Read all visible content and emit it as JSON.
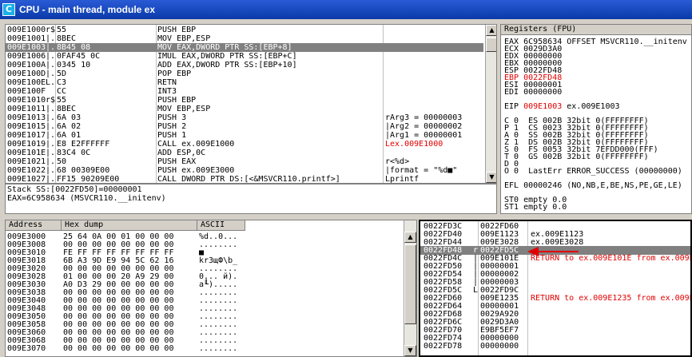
{
  "window": {
    "title": "CPU - main thread, module ex",
    "icon_letter": "C"
  },
  "cpu": {
    "rows": [
      {
        "addr": "009E1000",
        "mark": "r$",
        "bytes": "55",
        "asm": "PUSH EBP",
        "com": ""
      },
      {
        "addr": "009E1001",
        "mark": "|.",
        "bytes": "8BEC",
        "asm": "MOV EBP,ESP",
        "com": ""
      },
      {
        "addr": "009E1003",
        "mark": "|.",
        "bytes": "8B45 08",
        "asm": "MOV EAX,DWORD PTR SS:[EBP+8]",
        "com": ""
      },
      {
        "addr": "009E1006",
        "mark": "|.",
        "bytes": "0FAF45 0C",
        "asm": "IMUL EAX,DWORD PTR SS:[EBP+C]",
        "com": ""
      },
      {
        "addr": "009E100A",
        "mark": "|.",
        "bytes": "0345 10",
        "asm": "ADD EAX,DWORD PTR SS:[EBP+10]",
        "com": ""
      },
      {
        "addr": "009E100D",
        "mark": "|.",
        "bytes": "5D",
        "asm": "POP EBP",
        "com": ""
      },
      {
        "addr": "009E100E",
        "mark": "L.",
        "bytes": "C3",
        "asm": "RETN",
        "com": ""
      },
      {
        "addr": "009E100F",
        "mark": "  ",
        "bytes": "CC",
        "asm": "INT3",
        "com": ""
      },
      {
        "addr": "009E1010",
        "mark": "r$",
        "bytes": "55",
        "asm": "PUSH EBP",
        "com": ""
      },
      {
        "addr": "009E1011",
        "mark": "|.",
        "bytes": "8BEC",
        "asm": "MOV EBP,ESP",
        "com": ""
      },
      {
        "addr": "009E1013",
        "mark": "|.",
        "bytes": "6A 03",
        "asm": "PUSH 3",
        "com": "rArg3 = 00000003"
      },
      {
        "addr": "009E1015",
        "mark": "|.",
        "bytes": "6A 02",
        "asm": "PUSH 2",
        "com": "|Arg2 = 00000002"
      },
      {
        "addr": "009E1017",
        "mark": "|.",
        "bytes": "6A 01",
        "asm": "PUSH 1",
        "com": "|Arg1 = 00000001"
      },
      {
        "addr": "009E1019",
        "mark": "|.",
        "bytes": "E8 E2FFFFFF",
        "asm": "CALL ex.009E1000",
        "com": "Lex.009E1000"
      },
      {
        "addr": "009E101E",
        "mark": "|.",
        "bytes": "83C4 0C",
        "asm": "ADD ESP,0C",
        "com": ""
      },
      {
        "addr": "009E1021",
        "mark": "|.",
        "bytes": "50",
        "asm": "PUSH EAX",
        "com": "r<%d>"
      },
      {
        "addr": "009E1022",
        "mark": "|.",
        "bytes": "68 00309E00",
        "asm": "PUSH ex.009E3000",
        "com": "|format = \"%d■\""
      },
      {
        "addr": "009E1027",
        "mark": "|.",
        "bytes": "FF15 90209E00",
        "asm": "CALL DWORD PTR DS:[<&MSVCR110.printf>]",
        "com": "Lprintf"
      },
      {
        "addr": "009E102D",
        "mark": "|.",
        "bytes": "83C4 08",
        "asm": "ADD ESP,8",
        "com": ""
      }
    ],
    "selected_index": 2
  },
  "info": {
    "line1": "Stack SS:[0022FD50]=00000001",
    "line2": "EAX=6C958634 (MSVCR110.__initenv)"
  },
  "registers": {
    "header": "Registers (FPU)",
    "lines": [
      {
        "t": "EAX 6C958634 OFFSET MSVCR110.__initenv",
        "red": false
      },
      {
        "t": "ECX 0029D3A0",
        "red": false
      },
      {
        "t": "EDX 00000000",
        "red": false
      },
      {
        "t": "EBX 00000000",
        "red": false
      },
      {
        "t": "ESP 0022FD48",
        "red": false
      },
      {
        "t": "EBP 0022FD48",
        "red": true
      },
      {
        "t": "ESI 00000001",
        "red": false
      },
      {
        "t": "EDI 00000000",
        "red": false
      },
      {
        "t": "",
        "red": false
      },
      {
        "t": "EIP 009E1003 ex.009E1003",
        "red": false
      },
      {
        "t": "",
        "red": false
      },
      {
        "t": "C 0  ES 002B 32bit 0(FFFFFFFF)",
        "red": false
      },
      {
        "t": "P 1  CS 0023 32bit 0(FFFFFFFF)",
        "red": false
      },
      {
        "t": "A 0  SS 002B 32bit 0(FFFFFFFF)",
        "red": false
      },
      {
        "t": "Z 1  DS 002B 32bit 0(FFFFFFFF)",
        "red": false
      },
      {
        "t": "S 0  FS 0053 32bit 7EFDD000(FFF)",
        "red": false
      },
      {
        "t": "T 0  GS 002B 32bit 0(FFFFFFFF)",
        "red": false
      },
      {
        "t": "D 0",
        "red": false
      },
      {
        "t": "O 0  LastErr ERROR_SUCCESS (00000000)",
        "red": false
      },
      {
        "t": "",
        "red": false
      },
      {
        "t": "EFL 00000246 (NO,NB,E,BE,NS,PE,GE,LE)",
        "red": false
      },
      {
        "t": "",
        "red": false
      },
      {
        "t": "ST0 empty 0.0",
        "red": false
      },
      {
        "t": "ST1 empty 0.0",
        "red": false
      }
    ],
    "eip_value": "009E1003"
  },
  "dump": {
    "headers": {
      "address": "Address",
      "hex": "Hex dump",
      "ascii": "ASCII"
    },
    "rows": [
      {
        "addr": "009E3000",
        "hex": "25 64 0A 00 01 00 00 00",
        "ascii": "%d..0..."
      },
      {
        "addr": "009E3008",
        "hex": "00 00 00 00 00 00 00 00",
        "ascii": "........"
      },
      {
        "addr": "009E3010",
        "hex": "FE FF FF FF FF FF FF FF",
        "ascii": "■"
      },
      {
        "addr": "009E3018",
        "hex": "6B A3 9D E9 94 5C 62 16",
        "ascii": "kr3щФ\\b_"
      },
      {
        "addr": "009E3020",
        "hex": "00 00 00 00 00 00 00 00",
        "ascii": "........"
      },
      {
        "addr": "009E3028",
        "hex": "01 00 00 00 20 A9 29 00",
        "ascii": "0... й)."
      },
      {
        "addr": "009E3030",
        "hex": "A0 D3 29 00 00 00 00 00",
        "ascii": "a╙)....."
      },
      {
        "addr": "009E3038",
        "hex": "00 00 00 00 00 00 00 00",
        "ascii": "........"
      },
      {
        "addr": "009E3040",
        "hex": "00 00 00 00 00 00 00 00",
        "ascii": "........"
      },
      {
        "addr": "009E3048",
        "hex": "00 00 00 00 00 00 00 00",
        "ascii": "........"
      },
      {
        "addr": "009E3050",
        "hex": "00 00 00 00 00 00 00 00",
        "ascii": "........"
      },
      {
        "addr": "009E3058",
        "hex": "00 00 00 00 00 00 00 00",
        "ascii": "........"
      },
      {
        "addr": "009E3060",
        "hex": "00 00 00 00 00 00 00 00",
        "ascii": "........"
      },
      {
        "addr": "009E3068",
        "hex": "00 00 00 00 00 00 00 00",
        "ascii": "........"
      },
      {
        "addr": "009E3070",
        "hex": "00 00 00 00 00 00 00 00",
        "ascii": "........"
      }
    ]
  },
  "stack": {
    "rows": [
      {
        "addr": "0022FD3C",
        "mark": " ",
        "val": "0022FD60",
        "com": ""
      },
      {
        "addr": "0022FD40",
        "mark": " ",
        "val": "009E1123",
        "com": "ex.009E1123"
      },
      {
        "addr": "0022FD44",
        "mark": " ",
        "val": "009E3028",
        "com": "ex.009E3028"
      },
      {
        "addr": "0022FD48",
        "mark": "r",
        "val": "0022FD5C",
        "com": ""
      },
      {
        "addr": "0022FD4C",
        "mark": "|",
        "val": "009E101E",
        "com": "RETURN to ex.009E101E from ex.009E1000"
      },
      {
        "addr": "0022FD50",
        "mark": "|",
        "val": "00000001",
        "com": ""
      },
      {
        "addr": "0022FD54",
        "mark": "|",
        "val": "00000002",
        "com": ""
      },
      {
        "addr": "0022FD58",
        "mark": "|",
        "val": "00000003",
        "com": ""
      },
      {
        "addr": "0022FD5C",
        "mark": "L",
        "val": "0022FD9C",
        "com": ""
      },
      {
        "addr": "0022FD60",
        "mark": " ",
        "val": "009E1235",
        "com": "RETURN to ex.009E1235 from ex.009E1010"
      },
      {
        "addr": "0022FD64",
        "mark": " ",
        "val": "00000001",
        "com": ""
      },
      {
        "addr": "0022FD68",
        "mark": " ",
        "val": "0029A920",
        "com": ""
      },
      {
        "addr": "0022FD6C",
        "mark": " ",
        "val": "0029D3A0",
        "com": ""
      },
      {
        "addr": "0022FD70",
        "mark": " ",
        "val": "E9BF5EF7",
        "com": ""
      },
      {
        "addr": "0022FD74",
        "mark": " ",
        "val": "00000000",
        "com": ""
      },
      {
        "addr": "0022FD78",
        "mark": " ",
        "val": "00000000",
        "com": ""
      }
    ],
    "selected_index": 3
  },
  "colors": {
    "title_bar": "#0a3aa8",
    "highlight_red": "#e00000",
    "selection": "#808080",
    "chrome": "#d4d0c8"
  }
}
